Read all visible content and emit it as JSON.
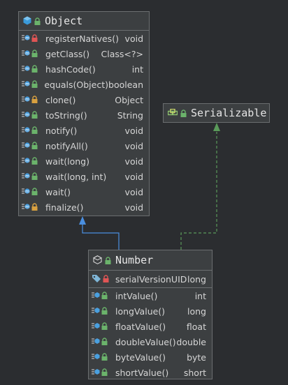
{
  "object_class": {
    "title": "Object",
    "methods": [
      {
        "name": "registerNatives()",
        "type": "void",
        "lock": "red"
      },
      {
        "name": "getClass()",
        "type": "Class<?>",
        "lock": "green"
      },
      {
        "name": "hashCode()",
        "type": "int",
        "lock": "green"
      },
      {
        "name": "equals(Object)",
        "type": "boolean",
        "lock": "green"
      },
      {
        "name": "clone()",
        "type": "Object",
        "lock": "orange"
      },
      {
        "name": "toString()",
        "type": "String",
        "lock": "green"
      },
      {
        "name": "notify()",
        "type": "void",
        "lock": "green"
      },
      {
        "name": "notifyAll()",
        "type": "void",
        "lock": "green"
      },
      {
        "name": "wait(long)",
        "type": "void",
        "lock": "green"
      },
      {
        "name": "wait(long, int)",
        "type": "void",
        "lock": "green"
      },
      {
        "name": "wait()",
        "type": "void",
        "lock": "green"
      },
      {
        "name": "finalize()",
        "type": "void",
        "lock": "orange"
      }
    ]
  },
  "serializable": {
    "title": "Serializable"
  },
  "number_class": {
    "title": "Number",
    "field": {
      "name": "serialVersionUID",
      "type": "long"
    },
    "methods": [
      {
        "name": "intValue()",
        "type": "int"
      },
      {
        "name": "longValue()",
        "type": "long"
      },
      {
        "name": "floatValue()",
        "type": "float"
      },
      {
        "name": "doubleValue()",
        "type": "double"
      },
      {
        "name": "byteValue()",
        "type": "byte"
      },
      {
        "name": "shortValue()",
        "type": "short"
      }
    ]
  },
  "colors": {
    "background": "#2b2d30",
    "box": "#3c3f41",
    "extends_arrow": "#4a8fe0",
    "implements_arrow": "#5a9a5a",
    "lock_green": "#6bb36b",
    "lock_red": "#e05555",
    "lock_orange": "#d8a040"
  }
}
